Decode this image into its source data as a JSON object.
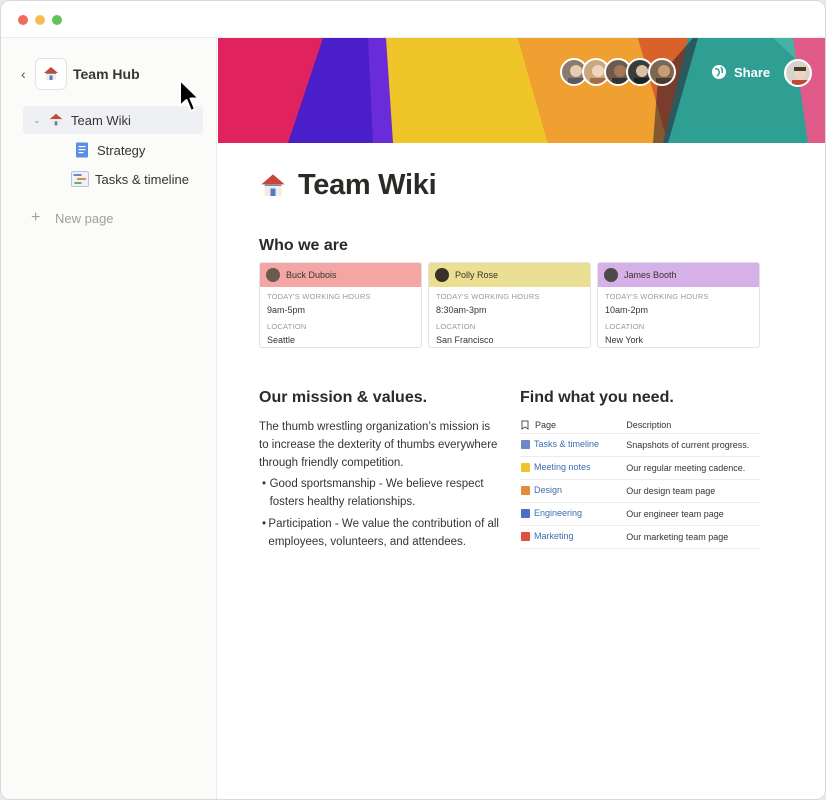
{
  "sidebar": {
    "hub_title": "Team Hub",
    "items": [
      {
        "label": "Team Wiki",
        "icon": "house-icon",
        "active": true
      },
      {
        "label": "Strategy",
        "icon": "document-icon"
      },
      {
        "label": "Tasks & timeline",
        "icon": "timeline-icon"
      }
    ],
    "new_page_label": "New page"
  },
  "header": {
    "share_label": "Share"
  },
  "page": {
    "title": "Team Wiki",
    "who_heading": "Who we are",
    "people": [
      {
        "name": "Buck Dubois",
        "hours_label": "TODAY'S WORKING HOURS",
        "hours": "9am-5pm",
        "location_label": "LOCATION",
        "location": "Seattle",
        "color": "#f3a6a4"
      },
      {
        "name": "Polly Rose",
        "hours_label": "TODAY'S WORKING HOURS",
        "hours": "8:30am-3pm",
        "location_label": "LOCATION",
        "location": "San Francisco",
        "color": "#eadf93"
      },
      {
        "name": "James Booth",
        "hours_label": "TODAY'S WORKING HOURS",
        "hours": "10am-2pm",
        "location_label": "LOCATION",
        "location": "New York",
        "color": "#d5b1e8"
      }
    ],
    "mission_heading": "Our mission & values.",
    "mission_text": "The thumb wrestling organization’s mission is to increase the dexterity of thumbs everywhere through friendly competition.",
    "values": [
      "Good sportsmanship - We believe respect fosters healthy relationships.",
      "Participation - We value the contribution of all employees, volunteers, and attendees."
    ],
    "find_heading": "Find what you need.",
    "table_headers": {
      "page": "Page",
      "description": "Description"
    },
    "table_rows": [
      {
        "page": "Tasks & timeline",
        "description": "Snapshots of current progress.",
        "icon_color": "#6f86c9"
      },
      {
        "page": "Meeting notes",
        "description": "Our regular meeting cadence.",
        "icon_color": "#f2c12e"
      },
      {
        "page": "Design",
        "description": "Our design team page",
        "icon_color": "#e58b3a"
      },
      {
        "page": "Engineering",
        "description": "Our engineer team page",
        "icon_color": "#4a6fc9"
      },
      {
        "page": "Marketing",
        "description": "Our marketing team page",
        "icon_color": "#e0503f"
      }
    ]
  },
  "colors": {
    "accent_link": "#3f6cb0",
    "sidebar_bg": "#fbfbfa",
    "active_item_bg": "#eef0f3"
  }
}
